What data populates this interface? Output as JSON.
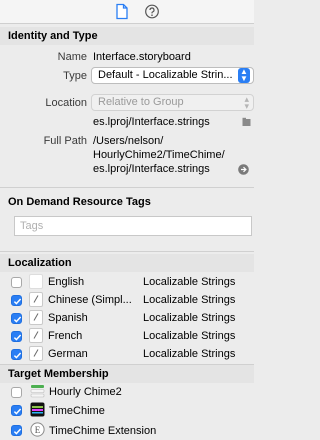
{
  "identity": {
    "title": "Identity and Type",
    "name_label": "Name",
    "name_value": "Interface.storyboard",
    "type_label": "Type",
    "type_value": "Default - Localizable Strin...",
    "location_label": "Location",
    "location_value": "Relative to Group",
    "location_file": "es.lproj/Interface.strings",
    "fullpath_label": "Full Path",
    "fullpath_lines": [
      "/Users/nelson/",
      "HourlyChime2/TimeChime/",
      "es.lproj/Interface.strings"
    ]
  },
  "odr": {
    "title": "On Demand Resource Tags",
    "tags_placeholder": "Tags"
  },
  "localization": {
    "title": "Localization",
    "rows": [
      {
        "name": "English",
        "type": "Localizable Strings",
        "checked": false
      },
      {
        "name": "Chinese (Simpl...",
        "type": "Localizable Strings",
        "checked": true
      },
      {
        "name": "Spanish",
        "type": "Localizable Strings",
        "checked": true
      },
      {
        "name": "French",
        "type": "Localizable Strings",
        "checked": true
      },
      {
        "name": "German",
        "type": "Localizable Strings",
        "checked": true
      }
    ]
  },
  "target": {
    "title": "Target Membership",
    "rows": [
      {
        "name": "Hourly Chime2",
        "checked": false
      },
      {
        "name": "TimeChime",
        "checked": true
      },
      {
        "name": "TimeChime Extension",
        "checked": true
      }
    ]
  },
  "colors": {
    "accent": "#2a7ef4",
    "header_bg": "#e4e4e4"
  }
}
